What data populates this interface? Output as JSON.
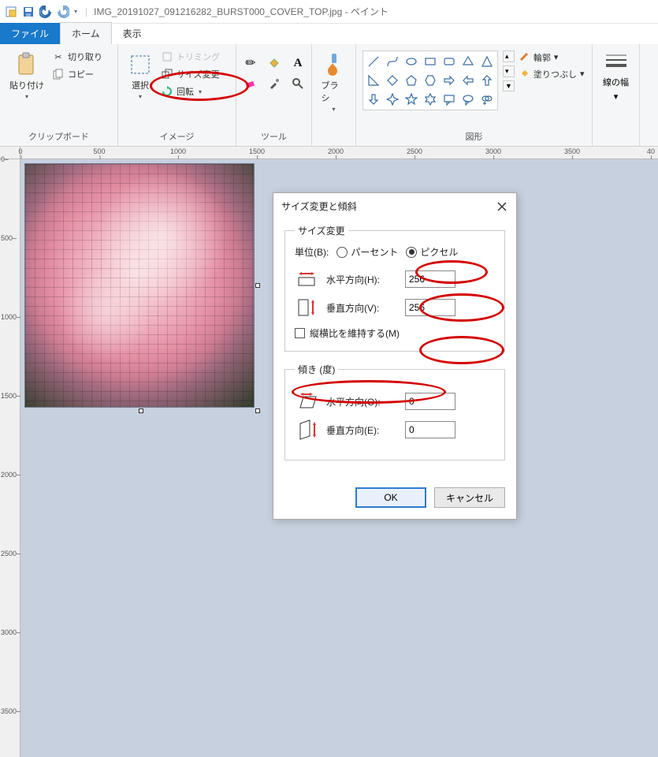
{
  "window": {
    "title_full": "IMG_20191027_091216282_BURST000_COVER_TOP.jpg - ペイント"
  },
  "tabs": {
    "file": "ファイル",
    "home": "ホーム",
    "view": "表示"
  },
  "ribbon": {
    "clipboard": {
      "paste": "貼り付け",
      "cut": "切り取り",
      "copy": "コピー",
      "label": "クリップボード"
    },
    "image": {
      "select": "選択",
      "trim": "トリミング",
      "resize": "サイズ変更",
      "rotate": "回転",
      "label": "イメージ"
    },
    "tools": {
      "label": "ツール"
    },
    "brush": {
      "label": "ブラシ"
    },
    "shapes": {
      "outline": "輪郭",
      "fill": "塗りつぶし",
      "label": "図形"
    },
    "linewidth": {
      "label": "線の幅"
    }
  },
  "canvas": {
    "ruler_h": [
      "0",
      "500",
      "1000",
      "1500",
      "2000",
      "2500",
      "3000",
      "3500",
      "40"
    ],
    "ruler_v": [
      "0",
      "500",
      "1000",
      "1500",
      "2000",
      "2500",
      "3000",
      "3500"
    ]
  },
  "dialog": {
    "title": "サイズ変更と傾斜",
    "resize_legend": "サイズ変更",
    "unit_label": "単位(B):",
    "unit_percent": "パーセント",
    "unit_pixel": "ピクセル",
    "horiz_label": "水平方向(H):",
    "vert_label": "垂直方向(V):",
    "horiz_value": "256",
    "vert_value": "256",
    "keep_aspect": "縦横比を維持する(M)",
    "skew_legend": "傾き (度)",
    "skew_h_label": "水平方向(O):",
    "skew_v_label": "垂直方向(E):",
    "skew_h_value": "0",
    "skew_v_value": "0",
    "ok": "OK",
    "cancel": "キャンセル"
  }
}
